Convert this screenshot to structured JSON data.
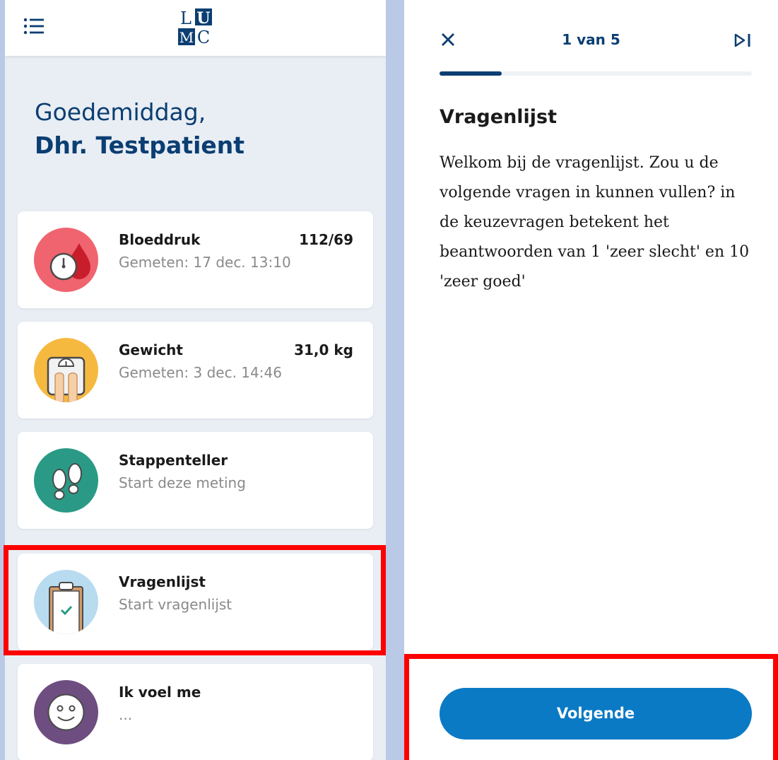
{
  "left": {
    "logo": "LUMC",
    "greeting": {
      "hello": "Goedemiddag,",
      "name": "Dhr. Testpatient"
    },
    "cards": [
      {
        "title": "Bloeddruk",
        "sub": "Gemeten: 17 dec. 13:10",
        "value": "112/69",
        "icon": "blood-pressure-icon",
        "color": "#f0646f"
      },
      {
        "title": "Gewicht",
        "sub": "Gemeten: 3 dec. 14:46",
        "value": "31,0 kg",
        "icon": "scale-icon",
        "color": "#f6b940"
      },
      {
        "title": "Stappenteller",
        "sub": "Start deze meting",
        "value": "",
        "icon": "footsteps-icon",
        "color": "#2a9a86"
      },
      {
        "title": "Vragenlijst",
        "sub": "Start vragenlijst",
        "value": "",
        "icon": "clipboard-icon",
        "color": "#b9dbf0"
      },
      {
        "title": "Ik voel me",
        "sub": "...",
        "value": "",
        "icon": "smiley-icon",
        "color": "#6e4e80"
      }
    ]
  },
  "right": {
    "step_label": "1 van 5",
    "progress": 0.2,
    "title": "Vragenlijst",
    "text": "Welkom bij de vragenlijst. Zou u de volgende vragen in kunnen vullen? in de keuzevragen betekent het beantwoorden van 1 'zeer slecht' en 10 'zeer goed'",
    "next_label": "Volgende"
  },
  "colors": {
    "brand_blue": "#0b3e72",
    "button_blue": "#0a7ac5",
    "highlight": "#ff0000"
  }
}
